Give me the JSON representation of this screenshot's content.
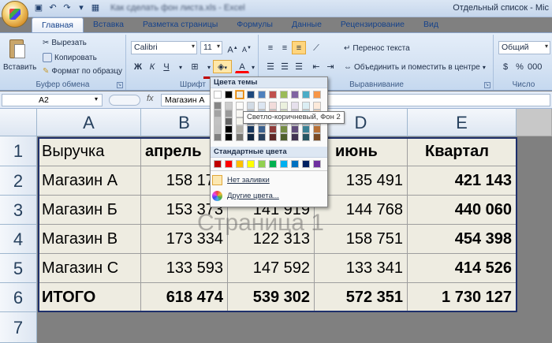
{
  "window": {
    "title_blurred": "Как сделать фон листа.xls - Excel",
    "title_right": "Отдельный список - Mic"
  },
  "tabs": [
    "Главная",
    "Вставка",
    "Разметка страницы",
    "Формулы",
    "Данные",
    "Рецензирование",
    "Вид"
  ],
  "ribbon": {
    "clipboard": {
      "paste": "Вставить",
      "cut": "Вырезать",
      "copy": "Копировать",
      "format_painter": "Формат по образцу",
      "label": "Буфер обмена"
    },
    "font": {
      "name": "Calibri",
      "size": "11",
      "bold": "Ж",
      "italic": "К",
      "underline": "Ч",
      "label": "Шрифт"
    },
    "alignment": {
      "wrap": "Перенос текста",
      "merge": "Объединить и поместить в центре",
      "label": "Выравнивание"
    },
    "number": {
      "format": "Общий",
      "label": "Число"
    }
  },
  "formula_bar": {
    "cell_ref": "A2",
    "fx": "fx",
    "value": "Магазин А"
  },
  "columns": [
    "A",
    "B",
    "C",
    "D",
    "E"
  ],
  "rows": [
    "1",
    "2",
    "3",
    "4",
    "5",
    "6",
    "7"
  ],
  "table": [
    [
      "Выручка",
      "апрель",
      "",
      "июнь",
      "Квартал"
    ],
    [
      "Магазин А",
      "158 174",
      "",
      "135 491",
      "421 143"
    ],
    [
      "Магазин Б",
      "153 373",
      "141 919",
      "144 768",
      "440 060"
    ],
    [
      "Магазин В",
      "173 334",
      "122 313",
      "158 751",
      "454 398"
    ],
    [
      "Магазин С",
      "133 593",
      "147 592",
      "133 341",
      "414 526"
    ],
    [
      "ИТОГО",
      "618 474",
      "539 302",
      "572 351",
      "1 730 127"
    ]
  ],
  "watermark": "Страница 1",
  "palette": {
    "theme_header": "Цвета темы",
    "standard_header": "Стандартные цвета",
    "no_fill": "Нет заливки",
    "more_colors": "Другие цвета...",
    "tooltip": "Светло-коричневый, Фон 2",
    "theme_top": [
      "#ffffff",
      "#000000",
      "#eeece1",
      "#1f497d",
      "#4f81bd",
      "#c0504d",
      "#9bbb59",
      "#8064a2",
      "#4bacc6",
      "#f79646"
    ],
    "standard": [
      "#c00000",
      "#ff0000",
      "#ffc000",
      "#ffff00",
      "#92d050",
      "#00b050",
      "#00b0f0",
      "#0070c0",
      "#002060",
      "#7030a0"
    ],
    "fill_accent": "#ffc000"
  }
}
